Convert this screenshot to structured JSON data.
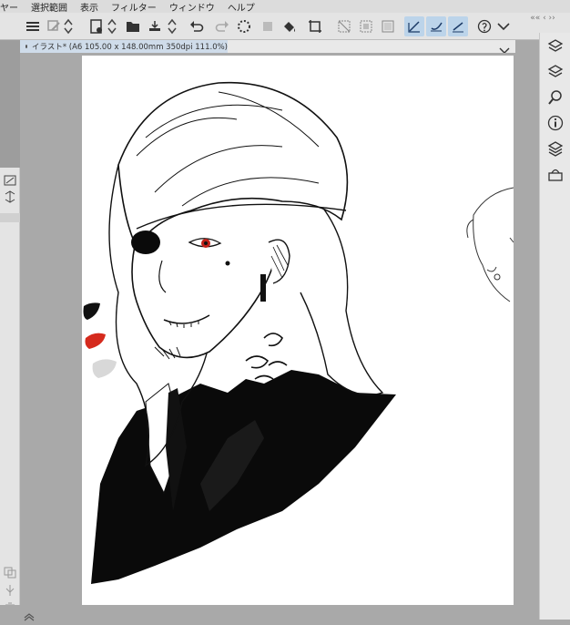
{
  "menubar": {
    "items": [
      "ヤー",
      "選択範囲",
      "表示",
      "フィルター",
      "ウィンドウ",
      "ヘルプ"
    ]
  },
  "document": {
    "tab_label": "イラスト* (A6 105.00 x 148.00mm 350dpi 111.0%)"
  },
  "toolbar": {
    "icons": [
      "menu-icon",
      "eraser-icon",
      "new-canvas-icon",
      "open-folder-icon",
      "save-icon",
      "print-icon",
      "undo-icon",
      "redo-icon",
      "loading-spinner-icon",
      "fill-icon",
      "crop-icon",
      "select-all-icon",
      "stylus-pen-icon",
      "help-icon"
    ]
  },
  "colors": {
    "accent": "#bcd4ea",
    "tab": "#cfdcea",
    "canvas_bg": "#a9a9a9",
    "paper": "#ffffff",
    "pupil": "#c0211a"
  }
}
